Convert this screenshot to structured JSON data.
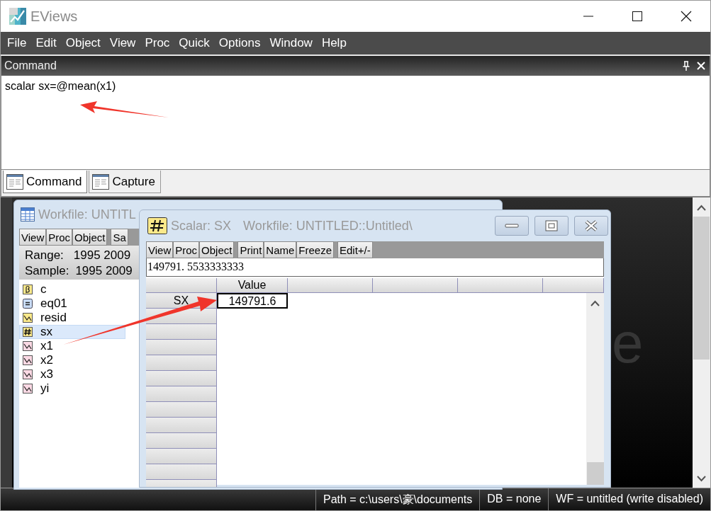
{
  "window": {
    "title": "EViews"
  },
  "menu": [
    "File",
    "Edit",
    "Object",
    "View",
    "Proc",
    "Quick",
    "Options",
    "Window",
    "Help"
  ],
  "command_pane": {
    "title": "Command",
    "text": "scalar sx=@mean(x1)"
  },
  "tabs": [
    {
      "label": "Command",
      "selected": true
    },
    {
      "label": "Capture",
      "selected": false
    }
  ],
  "desktop": {
    "background_text": "e"
  },
  "workfile_window": {
    "title": "Workfile: UNTITL",
    "toolbar_groups": [
      [
        "View",
        "Proc",
        "Object"
      ],
      [
        "Sa"
      ]
    ],
    "range_label": "Range:",
    "range": "1995 2009",
    "sample_label": "Sample:",
    "sample": "1995 2009",
    "objects": [
      {
        "name": "c",
        "kind": "coef",
        "selected": false
      },
      {
        "name": "eq01",
        "kind": "equation",
        "selected": false
      },
      {
        "name": "resid",
        "kind": "resid",
        "selected": false
      },
      {
        "name": "sx",
        "kind": "scalar",
        "selected": true
      },
      {
        "name": "x1",
        "kind": "series",
        "selected": false
      },
      {
        "name": "x2",
        "kind": "series",
        "selected": false
      },
      {
        "name": "x3",
        "kind": "series",
        "selected": false
      },
      {
        "name": "yi",
        "kind": "series",
        "selected": false
      }
    ]
  },
  "scalar_window": {
    "title": "Scalar: SX",
    "workfile": "Workfile: UNTITLED::Untitled\\",
    "toolbar_groups": [
      [
        "View",
        "Proc",
        "Object"
      ],
      [
        "Print",
        "Name",
        "Freeze"
      ],
      [
        "Edit+/-"
      ]
    ],
    "edit_value": "149791. 5533333333",
    "columns": [
      "Value"
    ],
    "rows": [
      {
        "label": "SX",
        "value": "149791.6",
        "selected": true
      }
    ]
  },
  "status_bar": [
    "Path = c:\\users\\豪\\documents",
    "DB = none",
    "WF = untitled (write disabled)"
  ]
}
